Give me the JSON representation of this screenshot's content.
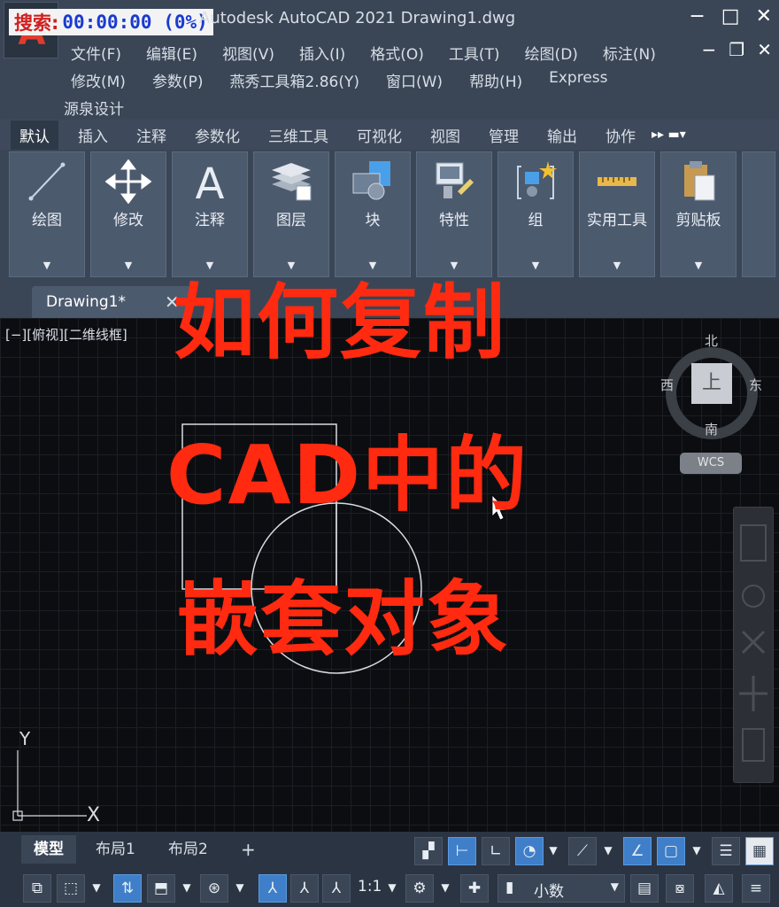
{
  "titlebar": {
    "search_label": "搜索:",
    "timer": "00:00:00 (0%)",
    "window_title": "Autodesk AutoCAD 2021    Drawing1.dwg",
    "minimize": "−",
    "maximize": "□",
    "close": "✕",
    "doc_minimize": "−",
    "doc_restore": "❐",
    "doc_close": "✕"
  },
  "menu": {
    "row1": [
      "文件(F)",
      "编辑(E)",
      "视图(V)",
      "插入(I)",
      "格式(O)",
      "工具(T)",
      "绘图(D)",
      "标注(N)"
    ],
    "row2": [
      "修改(M)",
      "参数(P)",
      "燕秀工具箱2.86(Y)",
      "窗口(W)",
      "帮助(H)",
      "Express"
    ],
    "row3": "源泉设计"
  },
  "ribbon_tabs": [
    "默认",
    "插入",
    "注释",
    "参数化",
    "三维工具",
    "可视化",
    "视图",
    "管理",
    "输出",
    "协作"
  ],
  "ribbon_panels": [
    "绘图",
    "修改",
    "注释",
    "图层",
    "块",
    "特性",
    "组",
    "实用工具",
    "剪贴板"
  ],
  "doc_tab": {
    "name": "Drawing1*",
    "close": "✕"
  },
  "canvas": {
    "view_label": "[−][俯视][二维线框]",
    "ucs_y": "Y",
    "ucs_x": "X"
  },
  "overlay": {
    "line1": "如何复制",
    "line2": "CAD中的",
    "line3": "嵌套对象",
    "color": "#ff2a10"
  },
  "viewcube": {
    "north": "北",
    "south": "南",
    "east": "东",
    "west": "西",
    "top": "上",
    "wcs": "WCS"
  },
  "layout_tabs": [
    "模型",
    "布局1",
    "布局2"
  ],
  "layout_add": "+",
  "status": {
    "scale": "1:1",
    "units": "小数"
  }
}
